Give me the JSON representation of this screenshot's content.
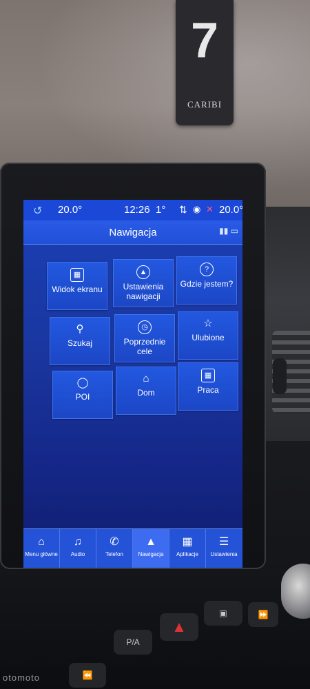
{
  "badge": {
    "number": "7",
    "brand": "CARIBI"
  },
  "status_bar": {
    "temp_left": "20.0°",
    "time": "12:26",
    "outside_temp": "1°",
    "temp_right": "20.0°"
  },
  "header": {
    "title": "Nawigacja"
  },
  "tiles": [
    {
      "label": "Widok ekranu",
      "icon": "screen-view-icon"
    },
    {
      "label": "Ustawienia nawigacji",
      "icon": "navigation-arrow-icon"
    },
    {
      "label": "Gdzie jestem?",
      "icon": "question-icon"
    },
    {
      "label": "Szukaj",
      "icon": "search-icon"
    },
    {
      "label": "Poprzednie cele",
      "icon": "history-icon"
    },
    {
      "label": "Ulubione",
      "icon": "star-icon"
    },
    {
      "label": "POI",
      "icon": "location-pin-icon"
    },
    {
      "label": "Dom",
      "icon": "home-icon"
    },
    {
      "label": "Praca",
      "icon": "building-icon"
    }
  ],
  "bottom_tabs": [
    {
      "label": "Menu główne",
      "icon": "home-icon"
    },
    {
      "label": "Audio",
      "icon": "music-icon"
    },
    {
      "label": "Telefon",
      "icon": "phone-icon"
    },
    {
      "label": "Nawigacja",
      "icon": "navigation-arrow-icon",
      "active": true
    },
    {
      "label": "Aplikacje",
      "icon": "apps-grid-icon"
    },
    {
      "label": "Ustawienia",
      "icon": "settings-sliders-icon"
    }
  ],
  "console": {
    "pa_label": "P/A"
  },
  "watermark": "otomoto"
}
